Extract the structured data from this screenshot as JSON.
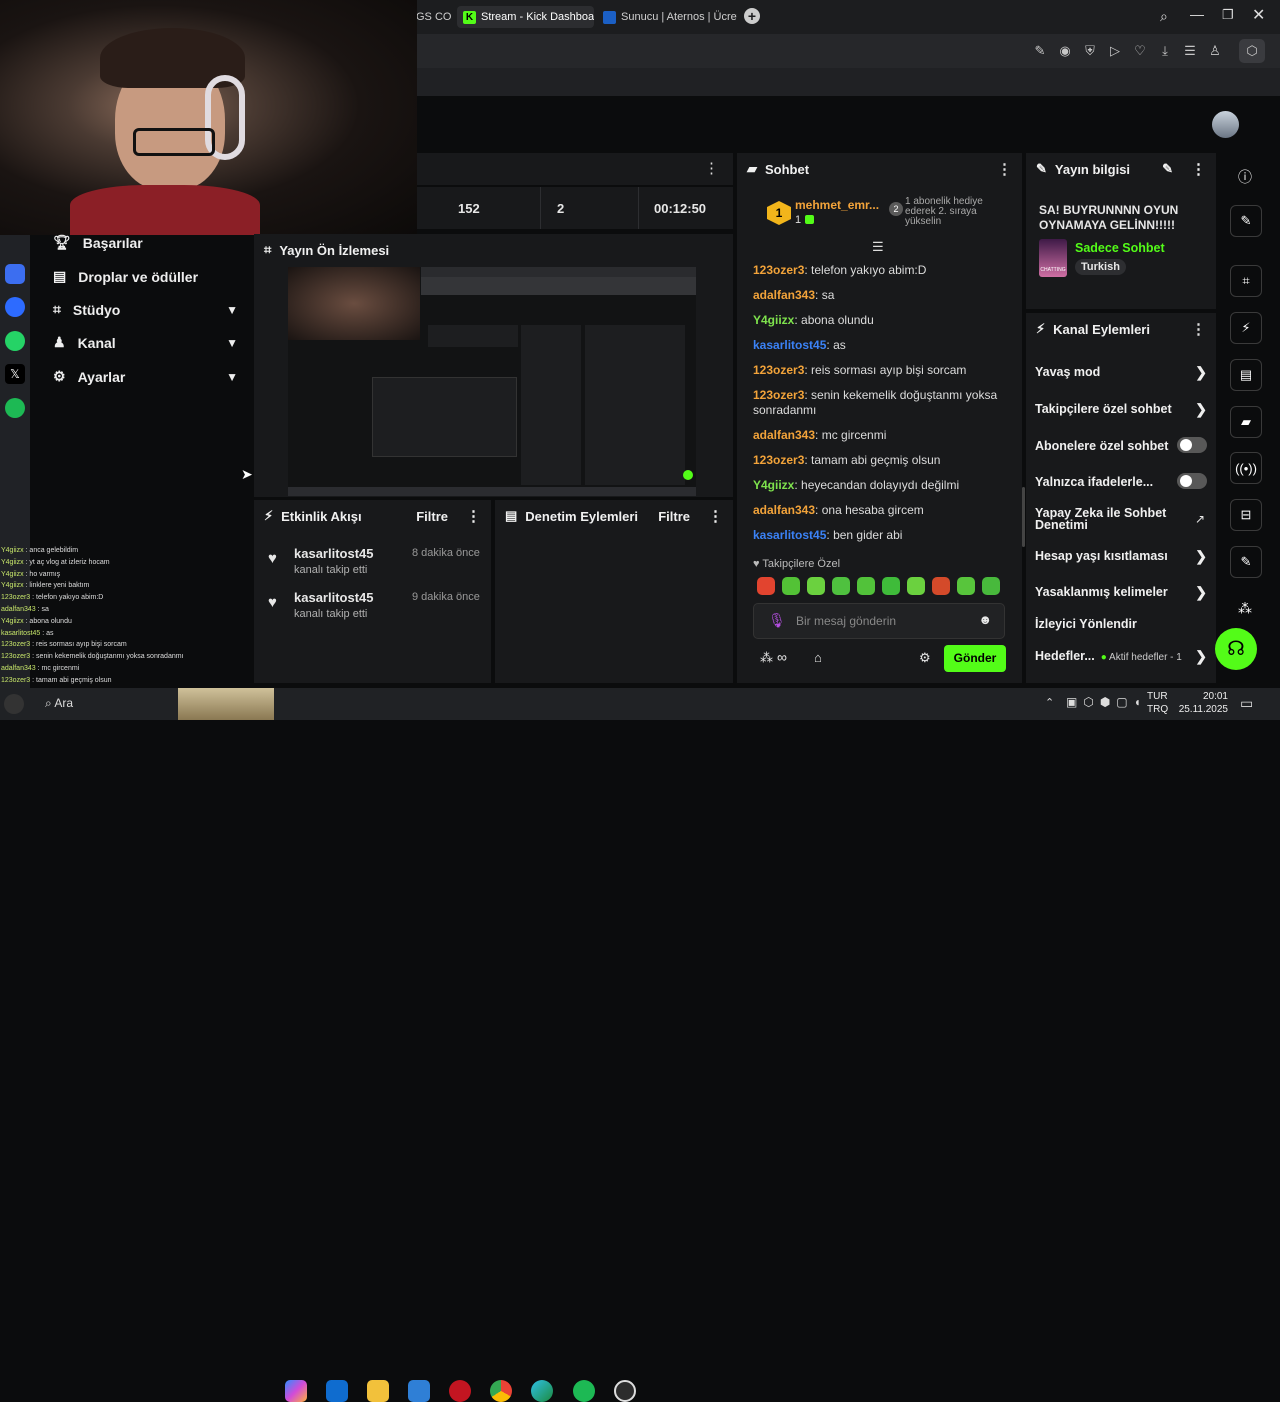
{
  "browser": {
    "tabs": [
      {
        "label": "GS COG"
      },
      {
        "label": "Stream - Kick Dashboard"
      },
      {
        "label": "Sunucu | Aternos | Ücretsiz"
      }
    ],
    "new_tab": "+"
  },
  "stats": {
    "v1": "152",
    "v2": "2",
    "v3": "00:12:50"
  },
  "sidebar": {
    "items": [
      {
        "label": "Başarılar"
      },
      {
        "label": "Droplar ve ödüller"
      },
      {
        "label": "Stüdyo"
      },
      {
        "label": "Kanal"
      },
      {
        "label": "Ayarlar"
      }
    ]
  },
  "preview": {
    "title": "Yayın Ön İzlemesi"
  },
  "activity": {
    "title": "Etkinlik Akışı",
    "filter": "Filtre",
    "items": [
      {
        "user": "kasarlitost45",
        "action": "kanalı takip etti",
        "time": "8 dakika önce"
      },
      {
        "user": "kasarlitost45",
        "action": "kanalı takip etti",
        "time": "9 dakika önce"
      }
    ]
  },
  "moderation": {
    "title": "Denetim Eylemleri",
    "filter": "Filtre"
  },
  "chat": {
    "title": "Sohbet",
    "pinned": {
      "user": "mehmet_emr...",
      "count": "1",
      "badge": "1",
      "text": "1 abonelik hediye ederek 2. sıraya yükselin"
    },
    "messages": [
      {
        "user": "123ozer3",
        "text": "telefon yakıyo abim:D",
        "color": "#f2a33a"
      },
      {
        "user": "adalfan343",
        "text": "sa",
        "color": "#f2a33a"
      },
      {
        "user": "Y4giizx",
        "text": "abona olundu",
        "color": "#7ee34d"
      },
      {
        "user": "kasarlitost45",
        "text": "as",
        "color": "#3b82f6"
      },
      {
        "user": "123ozer3",
        "text": "reis sorması ayıp bişi sorcam",
        "color": "#f2a33a"
      },
      {
        "user": "123ozer3",
        "text": "senin kekemelik doğuştanmı yoksa sonradanmı",
        "color": "#f2a33a"
      },
      {
        "user": "adalfan343",
        "text": "mc gircenmi",
        "color": "#f2a33a"
      },
      {
        "user": "123ozer3",
        "text": "tamam abi geçmiş olsun",
        "color": "#f2a33a"
      },
      {
        "user": "Y4giizx",
        "text": "heyecandan dolayıydı değilmi",
        "color": "#7ee34d"
      },
      {
        "user": "adalfan343",
        "text": "ona hesaba gircem",
        "color": "#f2a33a"
      },
      {
        "user": "kasarlitost45",
        "text": "ben gider abi",
        "color": "#3b82f6"
      }
    ],
    "emote_label": "Takipçilere Özel",
    "input_placeholder": "Bir mesaj gönderin",
    "send": "Gönder",
    "infinity": "∞"
  },
  "stream_info": {
    "title": "Yayın bilgisi",
    "stream_title": "SA! BUYRUNNNN OYUN OYNAMAYA GELİNN!!!!!",
    "category": "Sadece Sohbet",
    "tag": "Turkish",
    "thumb_text": "CHATTING"
  },
  "channel_actions": {
    "title": "Kanal Eylemleri",
    "items": [
      {
        "label": "Yavaş mod"
      },
      {
        "label": "Takipçilere özel sohbet"
      },
      {
        "label": "Abonelere özel sohbet"
      },
      {
        "label": "Yalnızca ifadelerle..."
      },
      {
        "label": "Yapay Zeka ile Sohbet Denetimi"
      },
      {
        "label": "Hesap yaşı kısıtlaması"
      },
      {
        "label": "Yasaklanmış kelimeler"
      },
      {
        "label": "İzleyici Yönlendir"
      },
      {
        "label": "Hedefler..."
      }
    ],
    "goal_status": "Aktif hedefler - 1"
  },
  "obs_chat": [
    {
      "user": "Y4giizx",
      "text": "anca gelebildim"
    },
    {
      "user": "Y4giizx",
      "text": "yt aç vlog at izleriz hocam"
    },
    {
      "user": "Y4giizx",
      "text": "ho varmış"
    },
    {
      "user": "Y4giizx",
      "text": "linklere yeni baktım"
    },
    {
      "user": "123ozer3",
      "text": "telefon yakıyo abim:D"
    },
    {
      "user": "adalfan343",
      "text": "sa"
    },
    {
      "user": "Y4giizx",
      "text": "abona olundu"
    },
    {
      "user": "kasarlitost45",
      "text": "as"
    },
    {
      "user": "123ozer3",
      "text": "reis sorması ayıp bişi sorcam"
    },
    {
      "user": "123ozer3",
      "text": "senin kekemelik doğuştanmı yoksa sonradanmı"
    },
    {
      "user": "adalfan343",
      "text": "mc gircenmi"
    },
    {
      "user": "123ozer3",
      "text": "tamam abi geçmiş olsun"
    },
    {
      "user": "Y4giizx",
      "text": "heyecandan dolayıydı değilmi"
    },
    {
      "user": "adalfan343",
      "text": "ona hesaba gircem"
    },
    {
      "user": "kasarlitost45",
      "text": "ben gider abi"
    }
  ],
  "taskbar": {
    "search": "Ara",
    "lang1": "TUR",
    "lang2": "TRQ",
    "time": "20:01",
    "date": "25.11.2025"
  },
  "colors": {
    "accent": "#53fc18",
    "panel": "#18191b",
    "bg": "#0b0c0d"
  }
}
